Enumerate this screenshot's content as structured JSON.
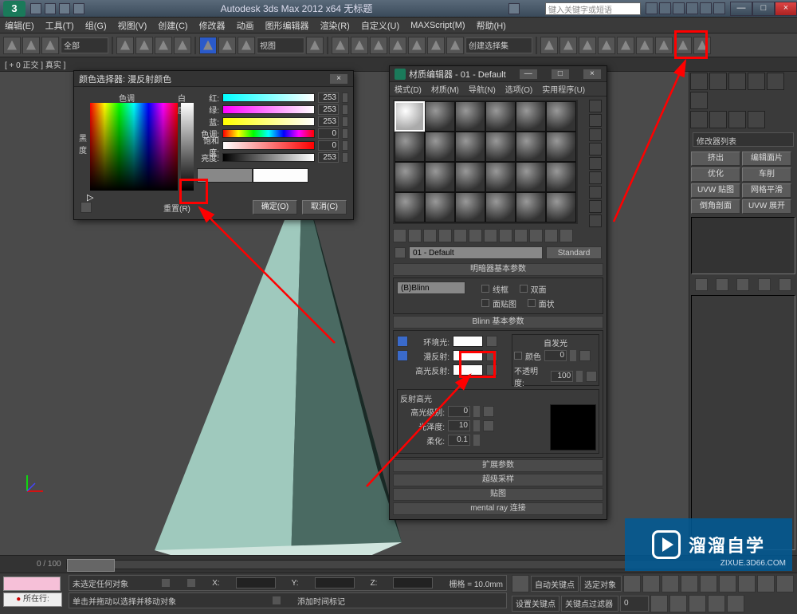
{
  "app": {
    "title": "Autodesk 3ds Max 2012 x64   无标题",
    "search_placeholder": "键入关键字或短语"
  },
  "window_buttons": {
    "min": "—",
    "max": "□",
    "close": "×"
  },
  "menubar": [
    "编辑(E)",
    "工具(T)",
    "组(G)",
    "视图(V)",
    "创建(C)",
    "修改器",
    "动画",
    "图形编辑器",
    "渲染(R)",
    "自定义(U)",
    "MAXScript(M)",
    "帮助(H)"
  ],
  "toolbar": {
    "dropdown1": "全部",
    "dropdown2": "视图",
    "dropdown3": "创建选择集"
  },
  "status_header": "[ + 0 正交 ] 真实 ]",
  "color_dialog": {
    "title": "颜色选择器: 漫反射颜色",
    "hue_label": "色调",
    "white_label": "白度",
    "black_label": "黑\n度",
    "channels": {
      "red": {
        "label": "红:",
        "value": "253"
      },
      "green": {
        "label": "绿:",
        "value": "253"
      },
      "blue": {
        "label": "蓝:",
        "value": "253"
      },
      "hue": {
        "label": "色调:",
        "value": "0"
      },
      "sat": {
        "label": "饱和度:",
        "value": "0"
      },
      "val": {
        "label": "亮度:",
        "value": "253"
      }
    },
    "reset": "重置(R)",
    "ok": "确定(O)",
    "cancel": "取消(C)"
  },
  "material_editor": {
    "title": "材质编辑器 - 01 - Default",
    "menus": [
      "模式(D)",
      "材质(M)",
      "导航(N)",
      "选项(O)",
      "实用程序(U)"
    ],
    "material_name": "01 - Default",
    "shader_type": "Standard",
    "rollouts": {
      "shader_basic": {
        "title": "明暗器基本参数",
        "shader": "(B)Blinn",
        "wire": "线框",
        "two_sided": "双面",
        "face_map": "面贴图",
        "faceted": "面状"
      },
      "blinn_basic": {
        "title": "Blinn 基本参数",
        "ambient": "环境光:",
        "diffuse": "漫反射:",
        "specular_color": "高光反射:",
        "self_illum": "自发光",
        "color_cb": "颜色",
        "color_val": "0",
        "opacity": "不透明度:",
        "opacity_val": "100",
        "spec_hdr": "反射高光",
        "spec_level": "高光级别:",
        "spec_level_val": "0",
        "gloss": "光泽度:",
        "gloss_val": "10",
        "soften": "柔化:",
        "soften_val": "0.1"
      },
      "extended": "扩展参数",
      "super": "超级采样",
      "maps": "贴图",
      "mental": "mental ray 连接"
    }
  },
  "cmd_panel": {
    "list_label": "修改器列表",
    "buttons": [
      "挤出",
      "编辑面片",
      "优化",
      "车削",
      "UVW 贴图",
      "网格平滑",
      "倒角剖面",
      "UVW 展开"
    ]
  },
  "timeline": {
    "range": "0 / 100"
  },
  "bottom": {
    "loc_btn": "所在行:",
    "status1": "未选定任何对象",
    "status2": "单击并拖动以选择并移动对象",
    "add_time": "添加时间标记",
    "x": "X:",
    "y": "Y:",
    "z": "Z:",
    "grid": "栅格 = 10.0mm",
    "auto_key": "自动关键点",
    "sel_set": "选定对象",
    "set_key": "设置关键点",
    "key_filter": "关键点过滤器"
  },
  "watermark": {
    "brand": "溜溜自学",
    "url": "ZIXUE.3D66.COM"
  }
}
